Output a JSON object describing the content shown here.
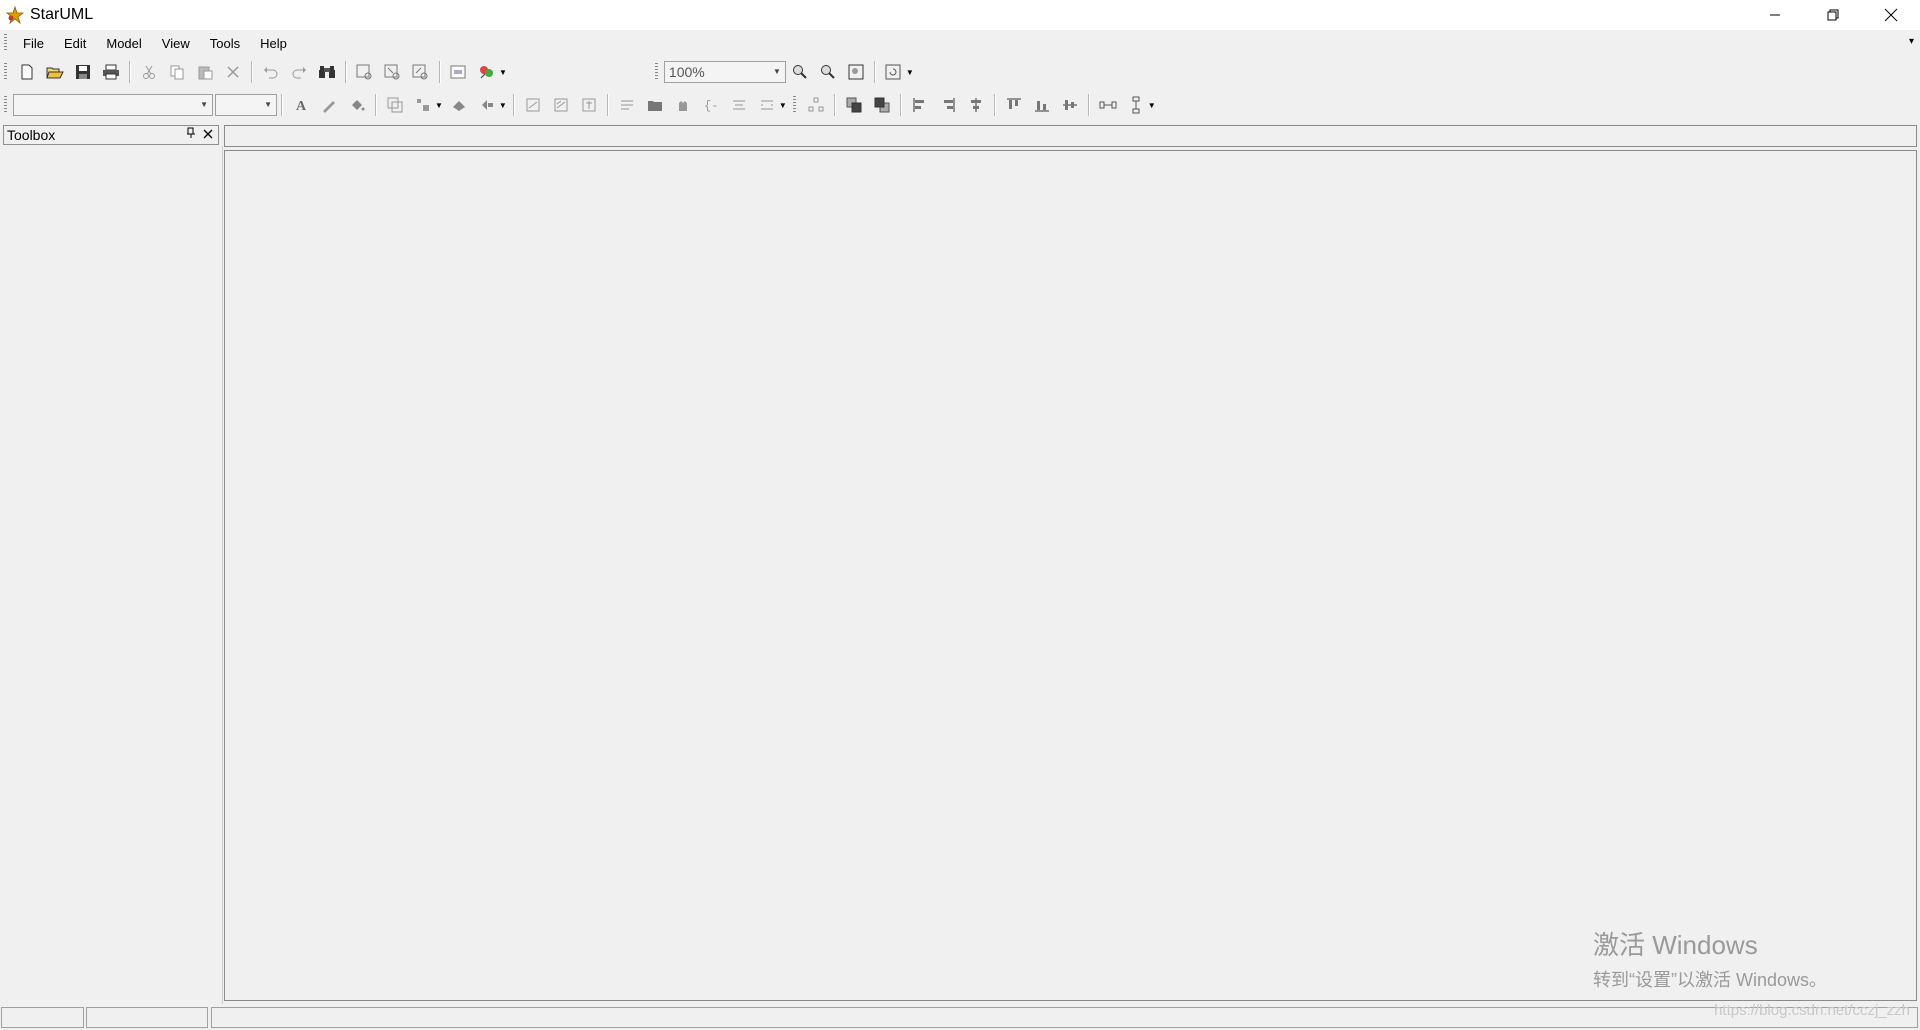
{
  "window": {
    "title": "StarUML",
    "controls": {
      "minimize": "—",
      "restore": "❐",
      "close": "✕"
    }
  },
  "menu": {
    "items": [
      {
        "label": "File"
      },
      {
        "label": "Edit"
      },
      {
        "label": "Model"
      },
      {
        "label": "View"
      },
      {
        "label": "Tools"
      },
      {
        "label": "Help"
      }
    ],
    "overflow": "▾"
  },
  "toolbar": {
    "zoom_value": "100%",
    "font_name": "",
    "font_size": ""
  },
  "toolbox": {
    "title": "Toolbox",
    "pin": "🖈",
    "close": "✕"
  },
  "watermark": {
    "line1": "激活 Windows",
    "line2": "转到“设置”以激活 Windows。"
  },
  "status": {
    "url": "https://blog.csdn.net/cczj_zzh"
  },
  "colors": {
    "background": "#f0f0f0",
    "titlebar": "#ffffff",
    "border": "#8a8a8a"
  }
}
